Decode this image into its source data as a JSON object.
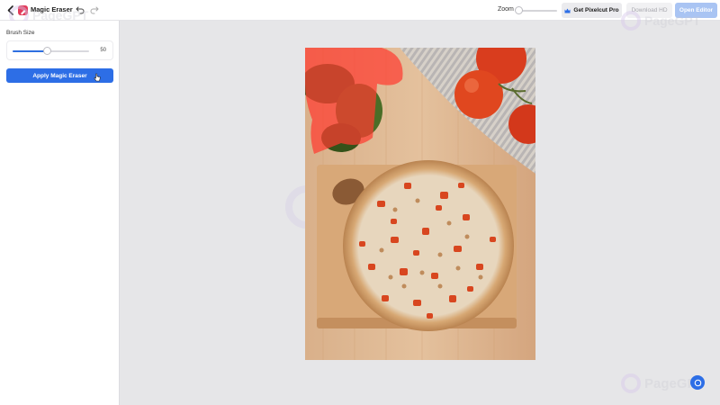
{
  "header": {
    "title": "Magic Eraser",
    "zoom_label": "Zoom",
    "zoom_level": 0,
    "pro_button": "Get Pixelcut Pro",
    "download_button": "Download HD",
    "editor_button": "Open Editor"
  },
  "sidebar": {
    "brush_label": "Brush Size",
    "brush_value": "50",
    "brush_fraction": 0.45,
    "apply_button": "Apply Magic Eraser"
  },
  "watermark": {
    "text": "PageGPT"
  },
  "colors": {
    "accent": "#2d6ee6",
    "app_icon": "#e23b5a",
    "mask": "#ff4c4c"
  },
  "icons": {
    "back": "chevron-left-icon",
    "undo": "undo-icon",
    "redo": "redo-icon",
    "crown": "crown-icon",
    "chat": "chat-icon"
  }
}
